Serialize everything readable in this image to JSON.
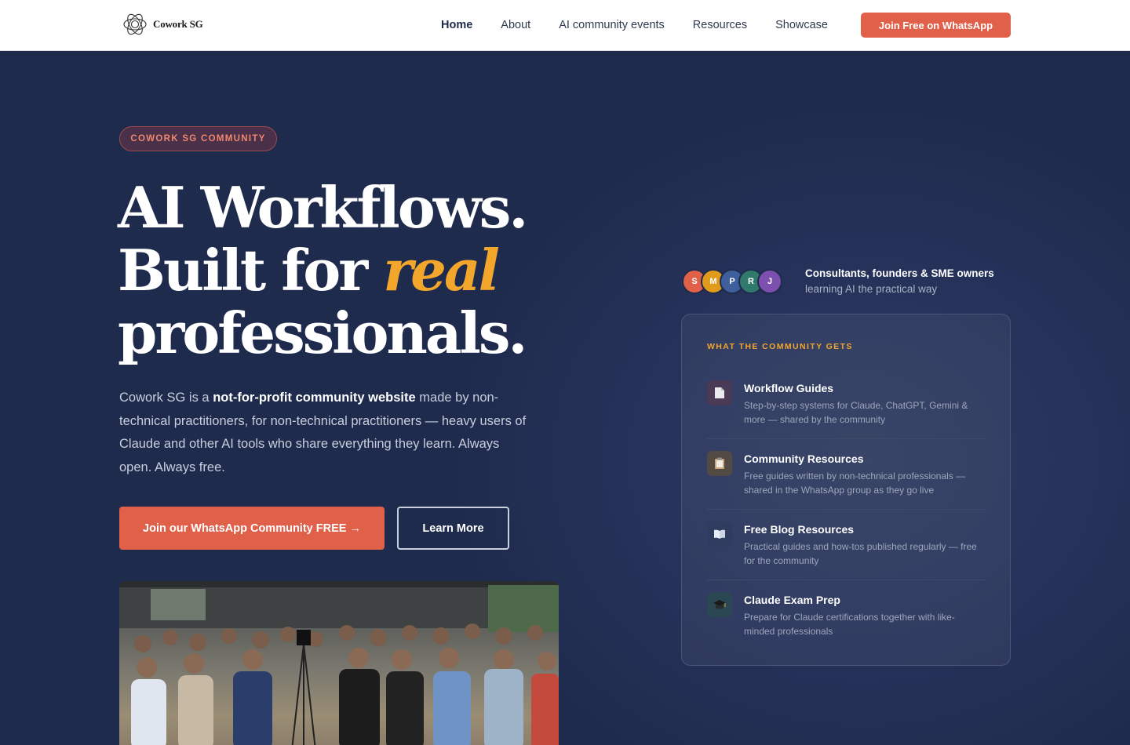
{
  "brand": {
    "name": "Cowork SG"
  },
  "nav": {
    "links": [
      "Home",
      "About",
      "AI community events",
      "Resources",
      "Showcase"
    ],
    "cta": "Join Free on WhatsApp"
  },
  "hero": {
    "pill": "COWORK SG COMMUNITY",
    "title_line1": "AI Workflows.",
    "title_line2_pre": "Built for ",
    "title_line2_accent": "real",
    "title_line3": "professionals.",
    "lead_pre": "Cowork SG is a ",
    "lead_bold": "not-for-profit community website",
    "lead_post": " made by non-technical practitioners, for non-technical practitioners — heavy users of Claude and other AI tools who share everything they learn. Always open. Always free.",
    "primary_cta": "Join our WhatsApp Community FREE →",
    "secondary_cta": "Learn More"
  },
  "social_proof": {
    "avatars": [
      {
        "initial": "S",
        "color": "#e0604a"
      },
      {
        "initial": "M",
        "color": "#e09a1c"
      },
      {
        "initial": "P",
        "color": "#3f5f9c"
      },
      {
        "initial": "R",
        "color": "#2f7a6c"
      },
      {
        "initial": "J",
        "color": "#7d4fae"
      }
    ],
    "title": "Consultants, founders & SME owners",
    "subtitle": "learning AI the practical way"
  },
  "card": {
    "label": "WHAT THE COMMUNITY GETS",
    "features": [
      {
        "icon": "document-icon",
        "title": "Workflow Guides",
        "desc": "Step-by-step systems for Claude, ChatGPT, Gemini & more — shared by the community"
      },
      {
        "icon": "clipboard-icon",
        "title": "Community Resources",
        "desc": "Free guides written by non-technical professionals — shared in the WhatsApp group as they go live"
      },
      {
        "icon": "book-icon",
        "title": "Free Blog Resources",
        "desc": "Practical guides and how-tos published regularly — free for the community"
      },
      {
        "icon": "graduation-cap-icon",
        "title": "Claude Exam Prep",
        "desc": "Prepare for Claude certifications together with like-minded professionals"
      }
    ]
  }
}
